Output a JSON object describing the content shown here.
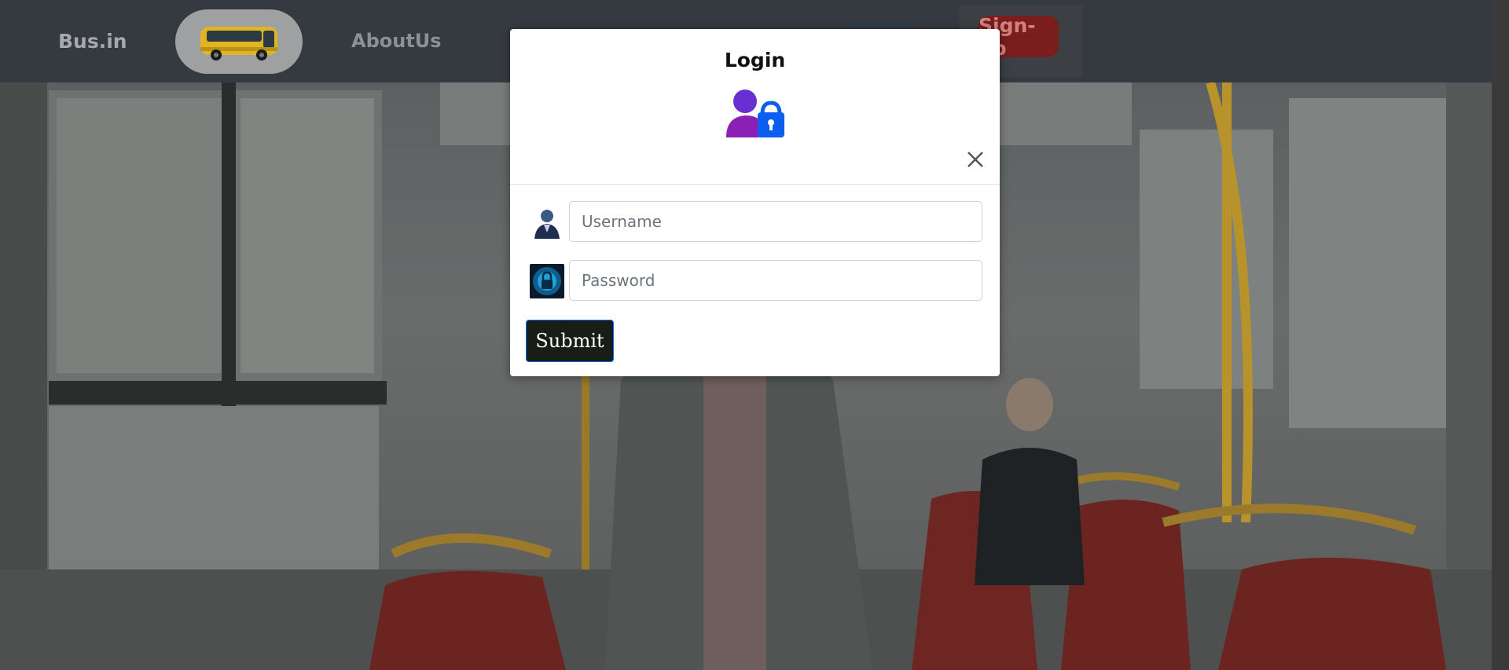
{
  "navbar": {
    "brand": "Bus.in",
    "about_link": "AboutUs",
    "signup_label": "Sign-up"
  },
  "modal": {
    "title": "Login",
    "username": {
      "placeholder": "Username",
      "value": ""
    },
    "password": {
      "placeholder": "Password",
      "value": ""
    },
    "submit_label": "Submit"
  },
  "colors": {
    "navbar_bg": "#343a40",
    "signup_red": "#dc3545",
    "submit_bg": "#1a1c16",
    "accent_blue": "#0d6efd",
    "user_icon_purple": "#7b2fcf",
    "lock_icon_blue": "#0d5ef0"
  },
  "icons": {
    "header_icon": "user-lock-icon",
    "username_icon": "user-avatar-icon",
    "password_icon": "padlock-icon",
    "close_icon": "close-icon"
  }
}
